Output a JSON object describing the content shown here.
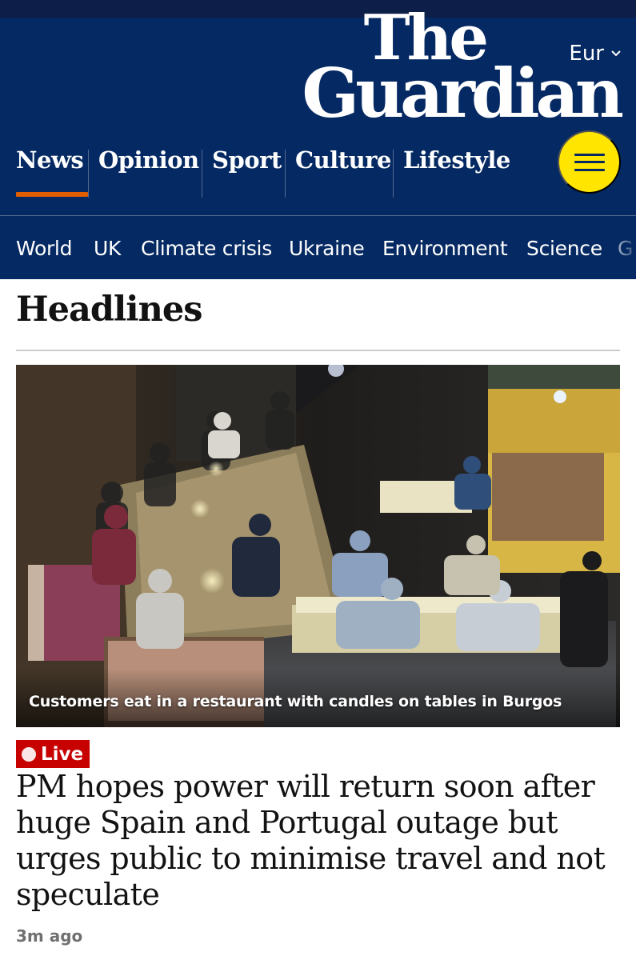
{
  "header": {
    "edition_label": "Eur",
    "logo_line1": "The",
    "logo_line2": "Guardian",
    "pillars": [
      {
        "label": "News",
        "active": true
      },
      {
        "label": "Opinion",
        "active": false
      },
      {
        "label": "Sport",
        "active": false
      },
      {
        "label": "Culture",
        "active": false
      },
      {
        "label": "Lifestyle",
        "active": false
      }
    ],
    "menu_icon": "hamburger-menu-icon",
    "subnav": [
      "World",
      "UK",
      "Climate crisis",
      "Ukraine",
      "Environment",
      "Science",
      "G"
    ]
  },
  "colors": {
    "brand_blue": "#052962",
    "accent_yellow": "#ffe500",
    "news_orange": "#e05e00",
    "live_red": "#c70000"
  },
  "section": {
    "title": "Headlines"
  },
  "lead_story": {
    "image_caption": "Customers eat in a restaurant with candles on tables in Burgos",
    "badge": "Live",
    "headline": "PM hopes power will return soon after huge Spain and Portugal outage but urges public to minimise travel and not speculate",
    "time_ago": "3m ago"
  }
}
